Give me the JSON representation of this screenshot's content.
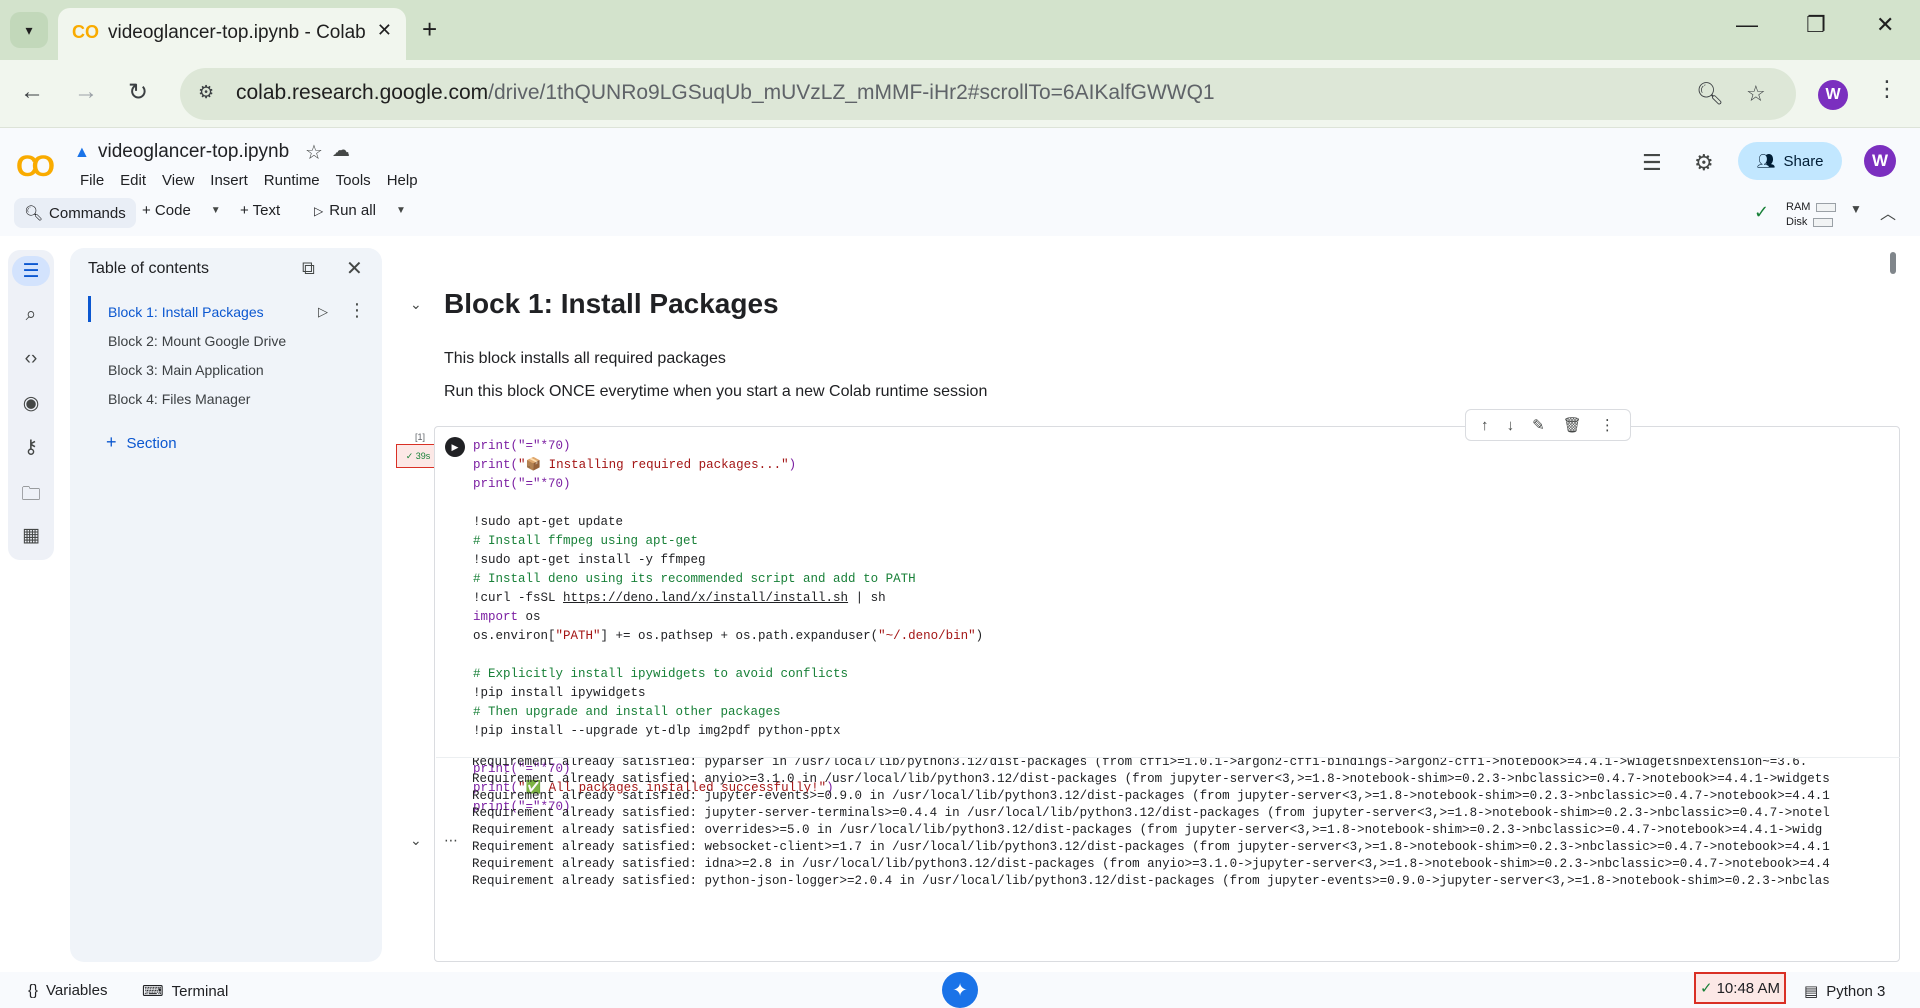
{
  "browser": {
    "tab_title": "videoglancer-top.ipynb - Colab",
    "tab_favicon": "colab-logo-icon",
    "new_tab": "+",
    "url_host": "colab.research.google.com",
    "url_path": "/drive/1thQUNRo9LGSuqUb_mUVzLZ_mMMF-iHr2#scrollTo=6AIKalfGWWQ1",
    "profile_initial": "W"
  },
  "colab": {
    "notebook_title": "videoglancer-top.ipynb",
    "menus": [
      "File",
      "Edit",
      "View",
      "Insert",
      "Runtime",
      "Tools",
      "Help"
    ],
    "share_label": "Share",
    "user_initial": "W",
    "commands_label": "Commands",
    "code_label": "+ Code",
    "text_label": "+ Text",
    "run_all_label": "Run all",
    "ram_label": "RAM",
    "disk_label": "Disk"
  },
  "toc": {
    "title": "Table of contents",
    "items": [
      {
        "label": "Block 1: Install Packages"
      },
      {
        "label": "Block 2: Mount Google Drive"
      },
      {
        "label": "Block 3: Main Application"
      },
      {
        "label": "Block 4: Files Manager"
      }
    ],
    "add_section": "Section"
  },
  "notebook": {
    "heading": "Block 1: Install Packages",
    "desc_1": "This block installs all required packages",
    "desc_2": "Run this block ONCE everytime when you start a new Colab runtime session",
    "cell_exec_count": "[1]",
    "cell_duration": "39s",
    "code": {
      "l1": "print(\"=\"*70)",
      "l2a": "print(",
      "l2b": "\"📦 Installing required packages...\"",
      "l2c": ")",
      "l3": "print(\"=\"*70)",
      "l5": "!sudo apt-get update",
      "l6": "# Install ffmpeg using apt-get",
      "l7": "!sudo apt-get install -y ffmpeg",
      "l8": "# Install deno using its recommended script and add to PATH",
      "l9a": "!curl -fsSL ",
      "l9b": "https://deno.land/x/install/install.sh",
      "l9c": " | sh",
      "l10a": "import",
      "l10b": " os",
      "l11a": "os.environ[",
      "l11b": "\"PATH\"",
      "l11c": "] += os.pathsep + os.path.expanduser(",
      "l11d": "\"~/.deno/bin\"",
      "l11e": ")",
      "l13": "# Explicitly install ipywidgets to avoid conflicts",
      "l14": "!pip install ipywidgets",
      "l15": "# Then upgrade and install other packages",
      "l16": "!pip install --upgrade yt-dlp img2pdf python-pptx",
      "l18": "print(\"=\"*70)",
      "l19a": "print(",
      "l19b": "\"✅ All packages installed successfully!\"",
      "l19c": ")",
      "l20": "print(\"=\"*70)"
    },
    "output_lines": [
      "Requirement already satisfied: pyparser in /usr/local/lib/python3.12/dist-packages (from cffi>=1.0.1->argon2-cffi-bindings->argon2-cffi->notebook>=4.4.1->widgetsnbextension~=3.6.",
      "Requirement already satisfied: anyio>=3.1.0 in /usr/local/lib/python3.12/dist-packages (from jupyter-server<3,>=1.8->notebook-shim>=0.2.3->nbclassic>=0.4.7->notebook>=4.4.1->widgets",
      "Requirement already satisfied: jupyter-events>=0.9.0 in /usr/local/lib/python3.12/dist-packages (from jupyter-server<3,>=1.8->notebook-shim>=0.2.3->nbclassic>=0.4.7->notebook>=4.4.1",
      "Requirement already satisfied: jupyter-server-terminals>=0.4.4 in /usr/local/lib/python3.12/dist-packages (from jupyter-server<3,>=1.8->notebook-shim>=0.2.3->nbclassic>=0.4.7->notel",
      "Requirement already satisfied: overrides>=5.0 in /usr/local/lib/python3.12/dist-packages (from jupyter-server<3,>=1.8->notebook-shim>=0.2.3->nbclassic>=0.4.7->notebook>=4.4.1->widg",
      "Requirement already satisfied: websocket-client>=1.7 in /usr/local/lib/python3.12/dist-packages (from jupyter-server<3,>=1.8->notebook-shim>=0.2.3->nbclassic>=0.4.7->notebook>=4.4.1",
      "Requirement already satisfied: idna>=2.8 in /usr/local/lib/python3.12/dist-packages (from anyio>=3.1.0->jupyter-server<3,>=1.8->notebook-shim>=0.2.3->nbclassic>=0.4.7->notebook>=4.4",
      "Requirement already satisfied: python-json-logger>=2.0.4 in /usr/local/lib/python3.12/dist-packages (from jupyter-events>=0.9.0->jupyter-server<3,>=1.8->notebook-shim>=0.2.3->nbclas"
    ]
  },
  "statusbar": {
    "variables_label": "Variables",
    "terminal_label": "Terminal",
    "time": "10:48 AM",
    "kernel": "Python 3"
  },
  "colors": {
    "accent": "#0b57d0",
    "share_bg": "#c2e7ff",
    "avatar": "#7b2fbf",
    "error_border": "#d93025",
    "ok_green": "#188038"
  }
}
